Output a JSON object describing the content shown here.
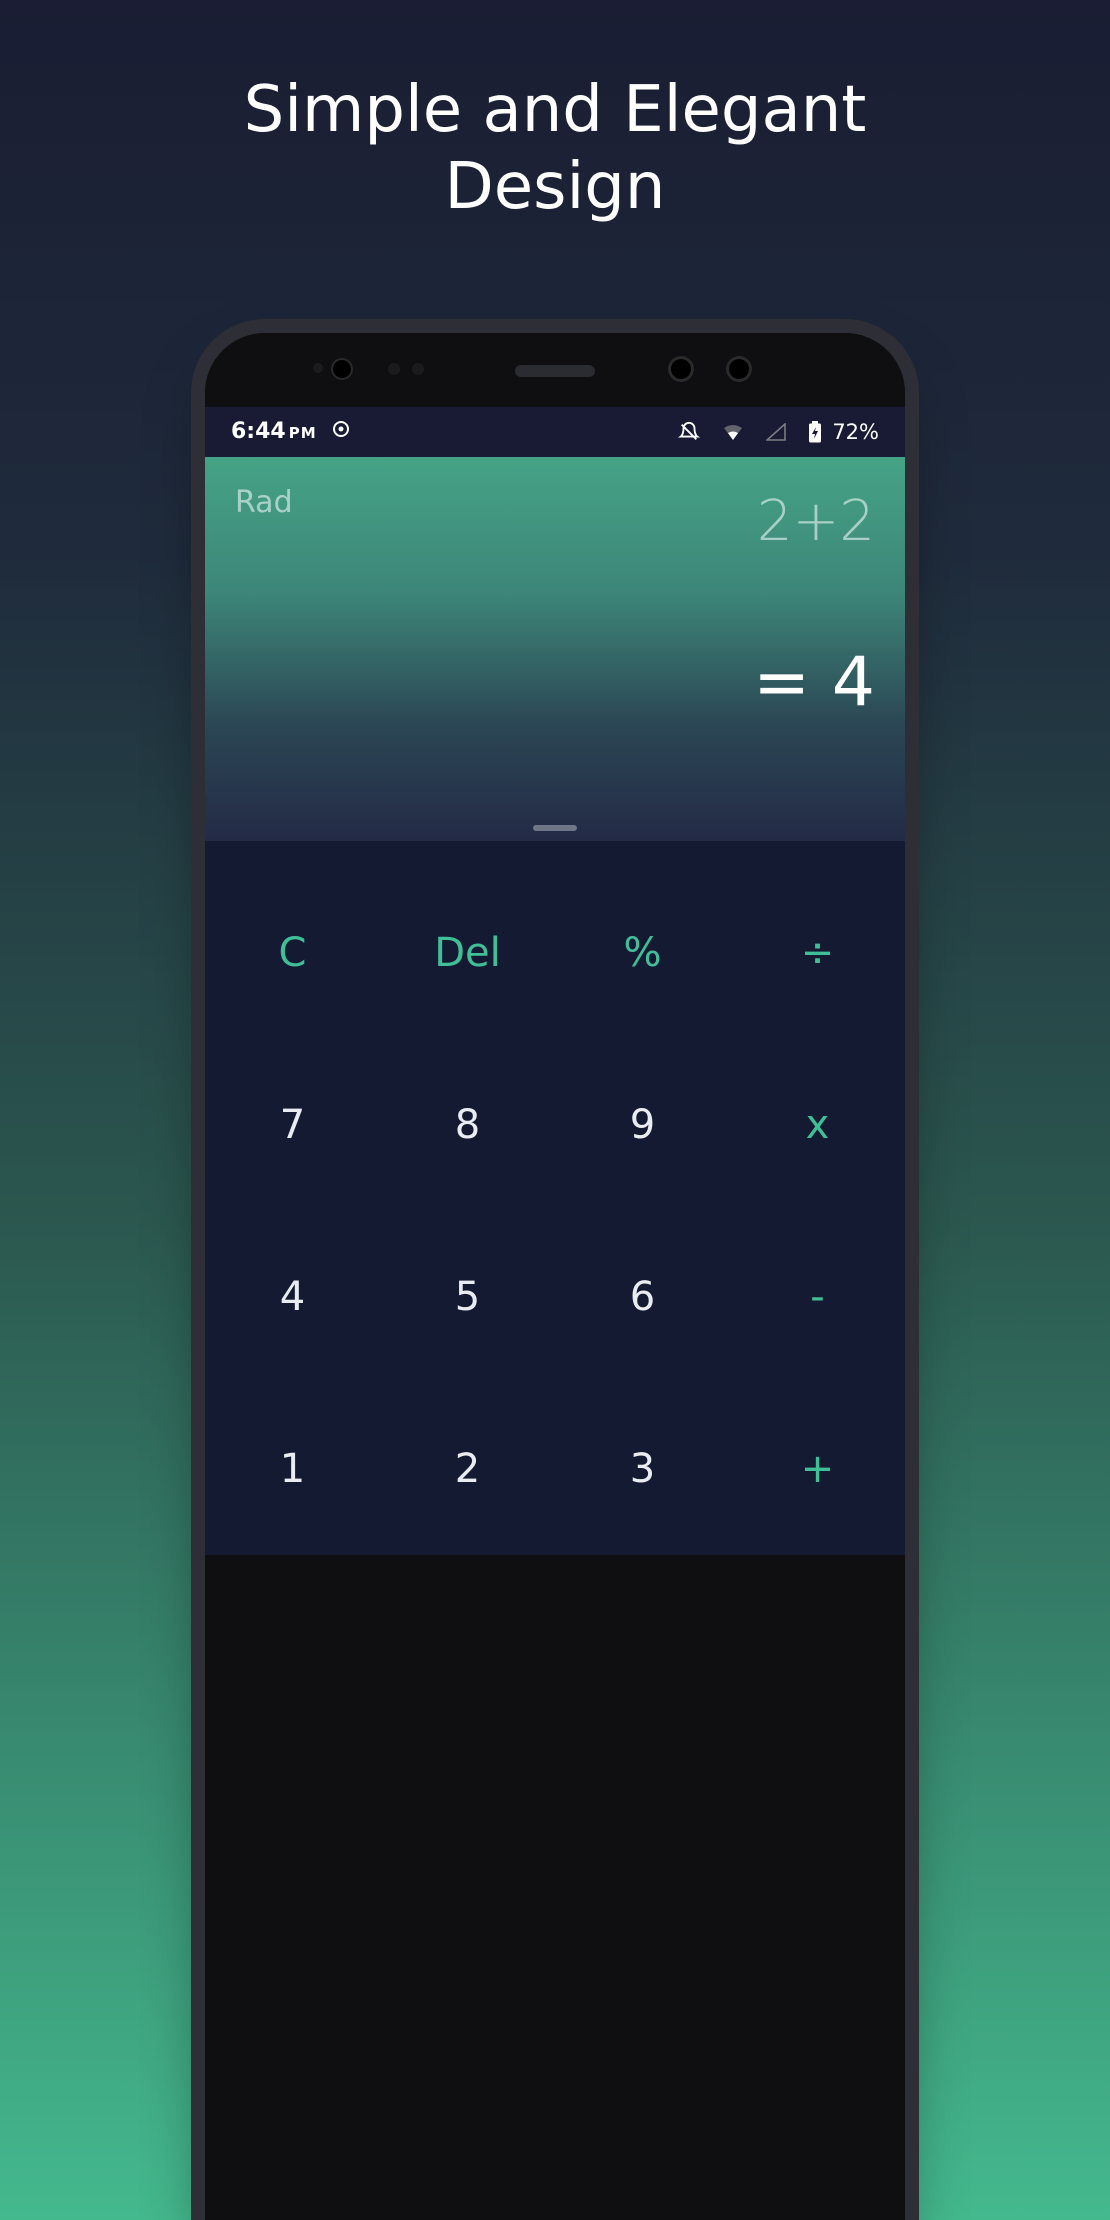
{
  "headline": "Simple and Elegant\nDesign",
  "statusbar": {
    "time": "6:44",
    "ampm": "PM",
    "battery": "72%"
  },
  "display": {
    "mode": "Rad",
    "expression": "2+2",
    "result": "= 4"
  },
  "keypad": {
    "row0": {
      "c0": "C",
      "c1": "Del",
      "c2": "%",
      "c3": "÷"
    },
    "row1": {
      "c0": "7",
      "c1": "8",
      "c2": "9",
      "c3": "x"
    },
    "row2": {
      "c0": "4",
      "c1": "5",
      "c2": "6",
      "c3": "-"
    },
    "row3": {
      "c0": "1",
      "c1": "2",
      "c2": "3",
      "c3": "+"
    }
  },
  "colors": {
    "accent": "#3fbf98",
    "keypad_bg": "#151a33",
    "status_bg": "#181b33"
  }
}
